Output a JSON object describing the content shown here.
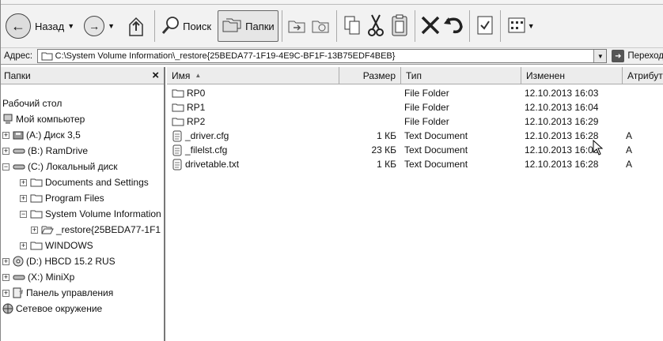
{
  "toolbar": {
    "back_label": "Назад",
    "search_label": "Поиск",
    "folders_label": "Папки"
  },
  "address": {
    "label": "Адрес:",
    "value": "C:\\System Volume Information\\_restore{25BEDA77-1F19-4E9C-BF1F-13B75EDF4BEB}",
    "go_label": "Переход"
  },
  "folders_pane": {
    "title": "Папки",
    "close": "×",
    "items": [
      {
        "label": "Рабочий стол",
        "icon": "desktop-icon"
      },
      {
        "label": "Мой компьютер",
        "icon": "computer-icon"
      },
      {
        "label": "(A:) Диск 3,5",
        "icon": "floppy-icon",
        "expander": "+"
      },
      {
        "label": "(B:) RamDrive",
        "icon": "drive-icon",
        "expander": "+"
      },
      {
        "label": "(C:) Локальный диск",
        "icon": "drive-icon",
        "expander": "−"
      },
      {
        "label": "Documents and Settings",
        "icon": "folder-icon",
        "expander": "+"
      },
      {
        "label": "Program Files",
        "icon": "folder-icon",
        "expander": "+"
      },
      {
        "label": "System Volume Information",
        "icon": "folder-icon",
        "expander": "−"
      },
      {
        "label": "_restore{25BEDA77-1F1",
        "icon": "folder-open-icon",
        "expander": "+"
      },
      {
        "label": "WINDOWS",
        "icon": "folder-icon",
        "expander": "+"
      },
      {
        "label": "(D:) HBCD 15.2 RUS",
        "icon": "cd-icon",
        "expander": "+"
      },
      {
        "label": "(X:) MiniXp",
        "icon": "drive-icon",
        "expander": "+"
      },
      {
        "label": "Панель управления",
        "icon": "control-panel-icon",
        "expander": "+"
      },
      {
        "label": "Сетевое окружение",
        "icon": "network-icon"
      }
    ]
  },
  "files": {
    "columns": {
      "name": "Имя",
      "name_sort": "▲",
      "size": "Размер",
      "type": "Тип",
      "modified": "Изменен",
      "attributes": "Атрибуты"
    },
    "rows": [
      {
        "name": "RP0",
        "size": "",
        "type": "File Folder",
        "modified": "12.10.2013 16:03",
        "attr": "",
        "icon": "folder-icon"
      },
      {
        "name": "RP1",
        "size": "",
        "type": "File Folder",
        "modified": "12.10.2013 16:04",
        "attr": "",
        "icon": "folder-icon"
      },
      {
        "name": "RP2",
        "size": "",
        "type": "File Folder",
        "modified": "12.10.2013 16:29",
        "attr": "",
        "icon": "folder-icon"
      },
      {
        "name": "_driver.cfg",
        "size": "1 КБ",
        "type": "Text Document",
        "modified": "12.10.2013 16:28",
        "attr": "A",
        "icon": "text-file-icon"
      },
      {
        "name": "_filelst.cfg",
        "size": "23 КБ",
        "type": "Text Document",
        "modified": "12.10.2013 16:03",
        "attr": "A",
        "icon": "text-file-icon"
      },
      {
        "name": "drivetable.txt",
        "size": "1 КБ",
        "type": "Text Document",
        "modified": "12.10.2013 16:28",
        "attr": "A",
        "icon": "text-file-icon"
      }
    ]
  }
}
